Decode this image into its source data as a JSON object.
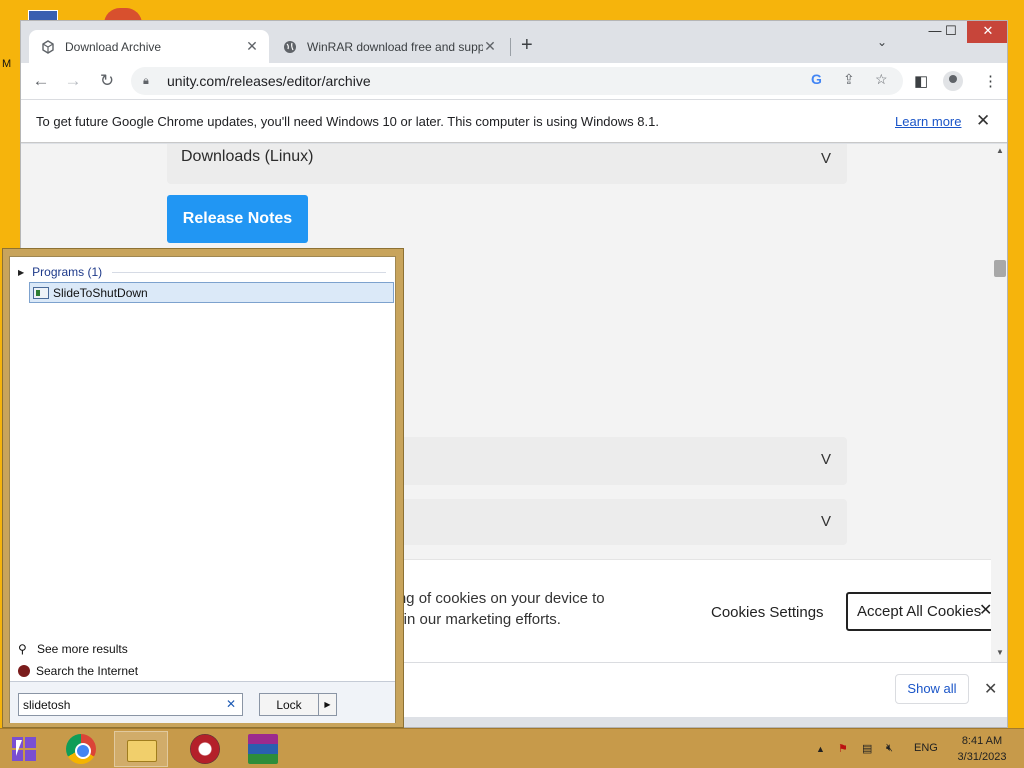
{
  "desktop": {
    "partial_label": "M"
  },
  "browser": {
    "tabs": [
      {
        "title": "Download Archive",
        "active": true,
        "icon": "unity-icon"
      },
      {
        "title": "WinRAR download free and supp",
        "active": false,
        "icon": "globe-icon"
      }
    ],
    "url": "unity.com/releases/editor/archive",
    "infobar": {
      "message": "To get future Google Chrome updates, you'll need Windows 10 or later. This computer is using Windows 8.1.",
      "link": "Learn more"
    },
    "page": {
      "accordion_top": {
        "label": "Downloads (Linux)",
        "chevron": "V"
      },
      "release_notes_button": "Release Notes",
      "accordion_2": {
        "chevron": "V"
      },
      "accordion_3": {
        "chevron": "V"
      }
    },
    "cookie_banner": {
      "text": "toring of cookies on your device to\nsist in our marketing efforts.",
      "settings_button": "Cookies Settings",
      "accept_button": "Accept All Cookies",
      "close": "✕"
    },
    "download_bar": {
      "show_all": "Show all"
    }
  },
  "start_menu": {
    "section_header": "Programs (1)",
    "results": [
      {
        "label": "SlideToShutDown"
      }
    ],
    "see_more": "See more results",
    "search_internet": "Search the Internet",
    "search_value": "slidetosh",
    "lock_label": "Lock"
  },
  "taskbar": {
    "language": "ENG",
    "time": "8:41 AM",
    "date": "3/31/2023"
  },
  "colors": {
    "desktop": "#f6b40c",
    "taskbar": "#c79a4a",
    "release_notes": "#2196f3"
  }
}
